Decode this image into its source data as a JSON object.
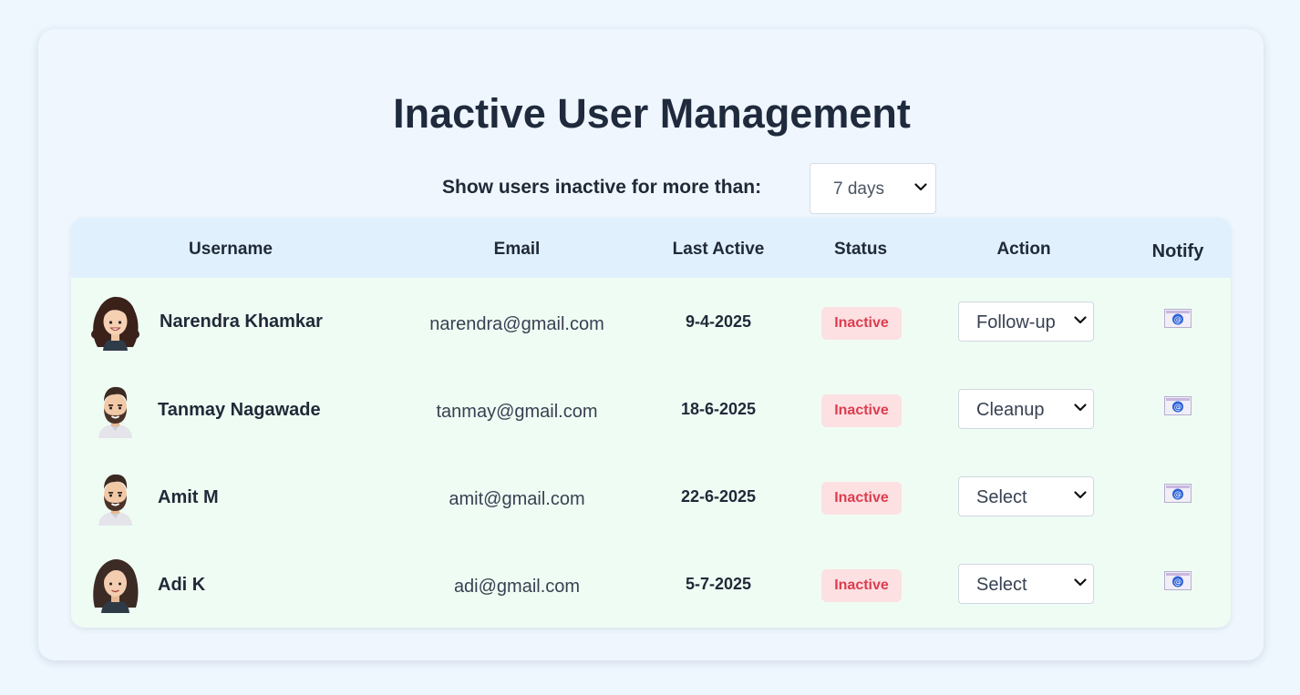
{
  "page": {
    "title": "Inactive User Management",
    "filter": {
      "label": "Show users inactive for more than:",
      "value": "7 days"
    }
  },
  "table": {
    "columns": [
      "Username",
      "Email",
      "Last Active",
      "Status",
      "Action",
      "Notify"
    ],
    "rows": [
      {
        "username": "Narendra Khamkar",
        "email": "narendra@gmail.com",
        "last_active": "9-4-2025",
        "status": "Inactive",
        "action": "Follow-up",
        "avatar": "avatar-woman-curly-hair"
      },
      {
        "username": "Tanmay Nagawade",
        "email": "tanmay@gmail.com",
        "last_active": "18-6-2025",
        "status": "Inactive",
        "action": "Cleanup",
        "avatar": "avatar-man-beard"
      },
      {
        "username": "Amit M",
        "email": "amit@gmail.com",
        "last_active": "22-6-2025",
        "status": "Inactive",
        "action": "Select",
        "avatar": "avatar-man-beard"
      },
      {
        "username": "Adi K",
        "email": "adi@gmail.com",
        "last_active": "5-7-2025",
        "status": "Inactive",
        "action": "Select",
        "avatar": "avatar-woman-long-hair"
      }
    ]
  },
  "icons": {
    "dropdown": "chevron-down-icon",
    "notify": "email-notify-icon"
  },
  "colors": {
    "background": "#eef6fe",
    "header_bg": "#e0f0fd",
    "rows_bg": "#effcf4",
    "badge_bg": "#fde0e2",
    "badge_text": "#dc3d4f",
    "title_text": "#1f2a3d"
  }
}
